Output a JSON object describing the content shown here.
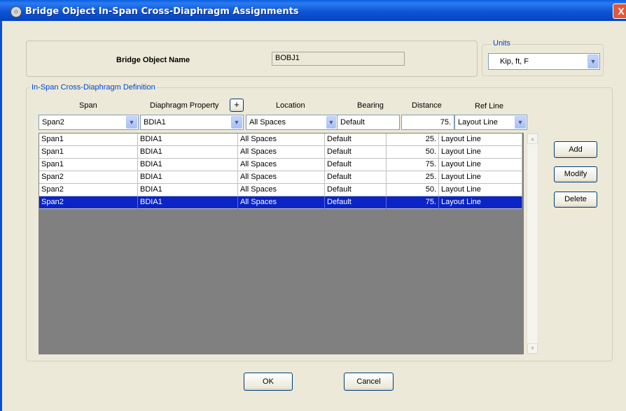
{
  "window": {
    "title": "Bridge Object In-Span Cross-Diaphragm Assignments",
    "close": "X"
  },
  "bridge_object": {
    "label": "Bridge Object Name",
    "value": "BOBJ1"
  },
  "units": {
    "legend": "Units",
    "value": "Kip, ft, F"
  },
  "definition": {
    "legend": "In-Span Cross-Diaphragm Definition",
    "headers": {
      "span": "Span",
      "diaphragm_property": "Diaphragm Property",
      "add_property": "+",
      "location": "Location",
      "bearing": "Bearing",
      "distance": "Distance",
      "ref_line": "Ref Line"
    },
    "editor": {
      "span": "Span2",
      "diaphragm_property": "BDIA1",
      "location": "All Spaces",
      "bearing": "Default",
      "distance": "75.",
      "ref_line": "Layout Line"
    },
    "rows": [
      {
        "span": "Span1",
        "property": "BDIA1",
        "location": "All Spaces",
        "bearing": "Default",
        "distance": "25.",
        "ref_line": "Layout Line",
        "selected": false
      },
      {
        "span": "Span1",
        "property": "BDIA1",
        "location": "All Spaces",
        "bearing": "Default",
        "distance": "50.",
        "ref_line": "Layout Line",
        "selected": false
      },
      {
        "span": "Span1",
        "property": "BDIA1",
        "location": "All Spaces",
        "bearing": "Default",
        "distance": "75.",
        "ref_line": "Layout Line",
        "selected": false
      },
      {
        "span": "Span2",
        "property": "BDIA1",
        "location": "All Spaces",
        "bearing": "Default",
        "distance": "25.",
        "ref_line": "Layout Line",
        "selected": false
      },
      {
        "span": "Span2",
        "property": "BDIA1",
        "location": "All Spaces",
        "bearing": "Default",
        "distance": "50.",
        "ref_line": "Layout Line",
        "selected": false
      },
      {
        "span": "Span2",
        "property": "BDIA1",
        "location": "All Spaces",
        "bearing": "Default",
        "distance": "75.",
        "ref_line": "Layout Line",
        "selected": true
      }
    ]
  },
  "buttons": {
    "add": "Add",
    "modify": "Modify",
    "delete": "Delete",
    "ok": "OK",
    "cancel": "Cancel"
  },
  "icons": {
    "app": "app-icon",
    "dropdown": "chevron-down-icon",
    "scroll_up": "scroll-up-icon",
    "scroll_down": "scroll-down-icon"
  },
  "colors": {
    "selection": "#0a24c6",
    "titlebar": "#0d55d6",
    "legend": "#0046d5",
    "grid_bg": "#808080"
  }
}
